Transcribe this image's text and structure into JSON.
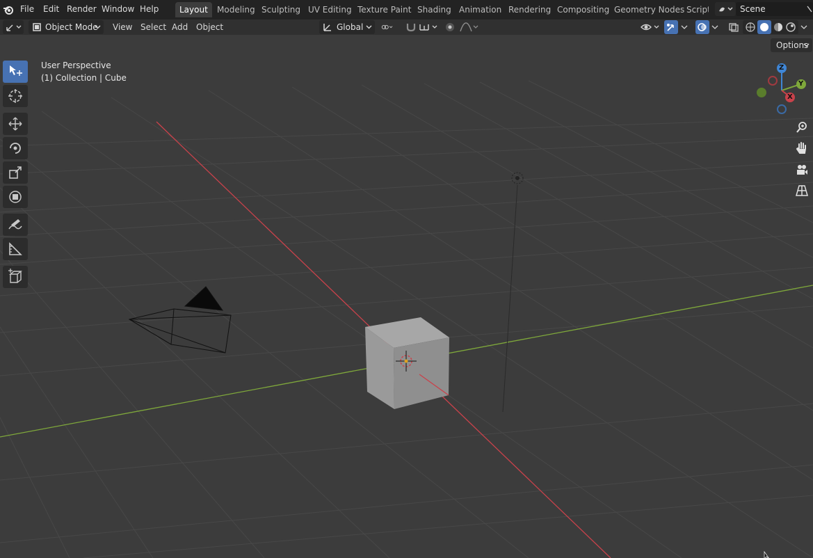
{
  "menu": {
    "file": "File",
    "edit": "Edit",
    "render": "Render",
    "window": "Window",
    "help": "Help"
  },
  "workspaces": [
    {
      "label": "Layout",
      "active": true
    },
    {
      "label": "Modeling"
    },
    {
      "label": "Sculpting"
    },
    {
      "label": "UV Editing"
    },
    {
      "label": "Texture Paint"
    },
    {
      "label": "Shading"
    },
    {
      "label": "Animation"
    },
    {
      "label": "Rendering"
    },
    {
      "label": "Compositing"
    },
    {
      "label": "Geometry Nodes"
    },
    {
      "label": "Scripti"
    }
  ],
  "scene": {
    "name": "Scene"
  },
  "header": {
    "mode": "Object Mode",
    "view": "View",
    "select": "Select",
    "add": "Add",
    "object": "Object",
    "orientation": "Global"
  },
  "viewport": {
    "perspective": "User Perspective",
    "collection": "(1) Collection | Cube",
    "options": "Options"
  },
  "gizmo": {
    "z": "Z",
    "y": "Y",
    "x": "X"
  },
  "colors": {
    "accent": "#4772b3",
    "axis_x": "#c9424b",
    "axis_y": "#7fa83b",
    "axis_z": "#3f86d6"
  }
}
